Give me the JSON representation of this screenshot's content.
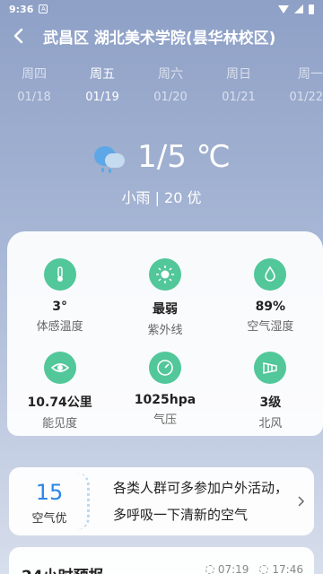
{
  "status_bar": {
    "time": "9:36",
    "notif": "A"
  },
  "header": {
    "title": "武昌区 湖北美术学院(昙华林校区)"
  },
  "days": [
    {
      "weekday": "周四",
      "date": "01/18",
      "active": false
    },
    {
      "weekday": "周五",
      "date": "01/19",
      "active": true
    },
    {
      "weekday": "周六",
      "date": "01/20",
      "active": false
    },
    {
      "weekday": "周日",
      "date": "01/21",
      "active": false
    },
    {
      "weekday": "周一",
      "date": "01/22",
      "active": false
    }
  ],
  "current": {
    "temp": "1/5 ℃",
    "desc": "小雨 | 20 优",
    "icon": "light-rain-icon"
  },
  "details": [
    {
      "value": "3°",
      "label": "体感温度",
      "icon": "thermometer-icon"
    },
    {
      "value": "最弱",
      "label": "紫外线",
      "icon": "sun-icon"
    },
    {
      "value": "89%",
      "label": "空气湿度",
      "icon": "droplet-icon"
    },
    {
      "value": "10.74公里",
      "label": "能见度",
      "icon": "eye-icon"
    },
    {
      "value": "1025hpa",
      "label": "气压",
      "icon": "gauge-icon"
    },
    {
      "value": "3级",
      "label": "北风",
      "icon": "windsock-icon"
    }
  ],
  "air_quality": {
    "value": "15",
    "label": "空气优",
    "text": "各类人群可多参加户外活动，多呼吸一下清新的空气"
  },
  "hourly": {
    "title": "24小时预报",
    "sunrise": "07:19",
    "sunset": "17:46"
  },
  "colors": {
    "accent": "#52c79a",
    "aqi": "#2a86e6"
  }
}
